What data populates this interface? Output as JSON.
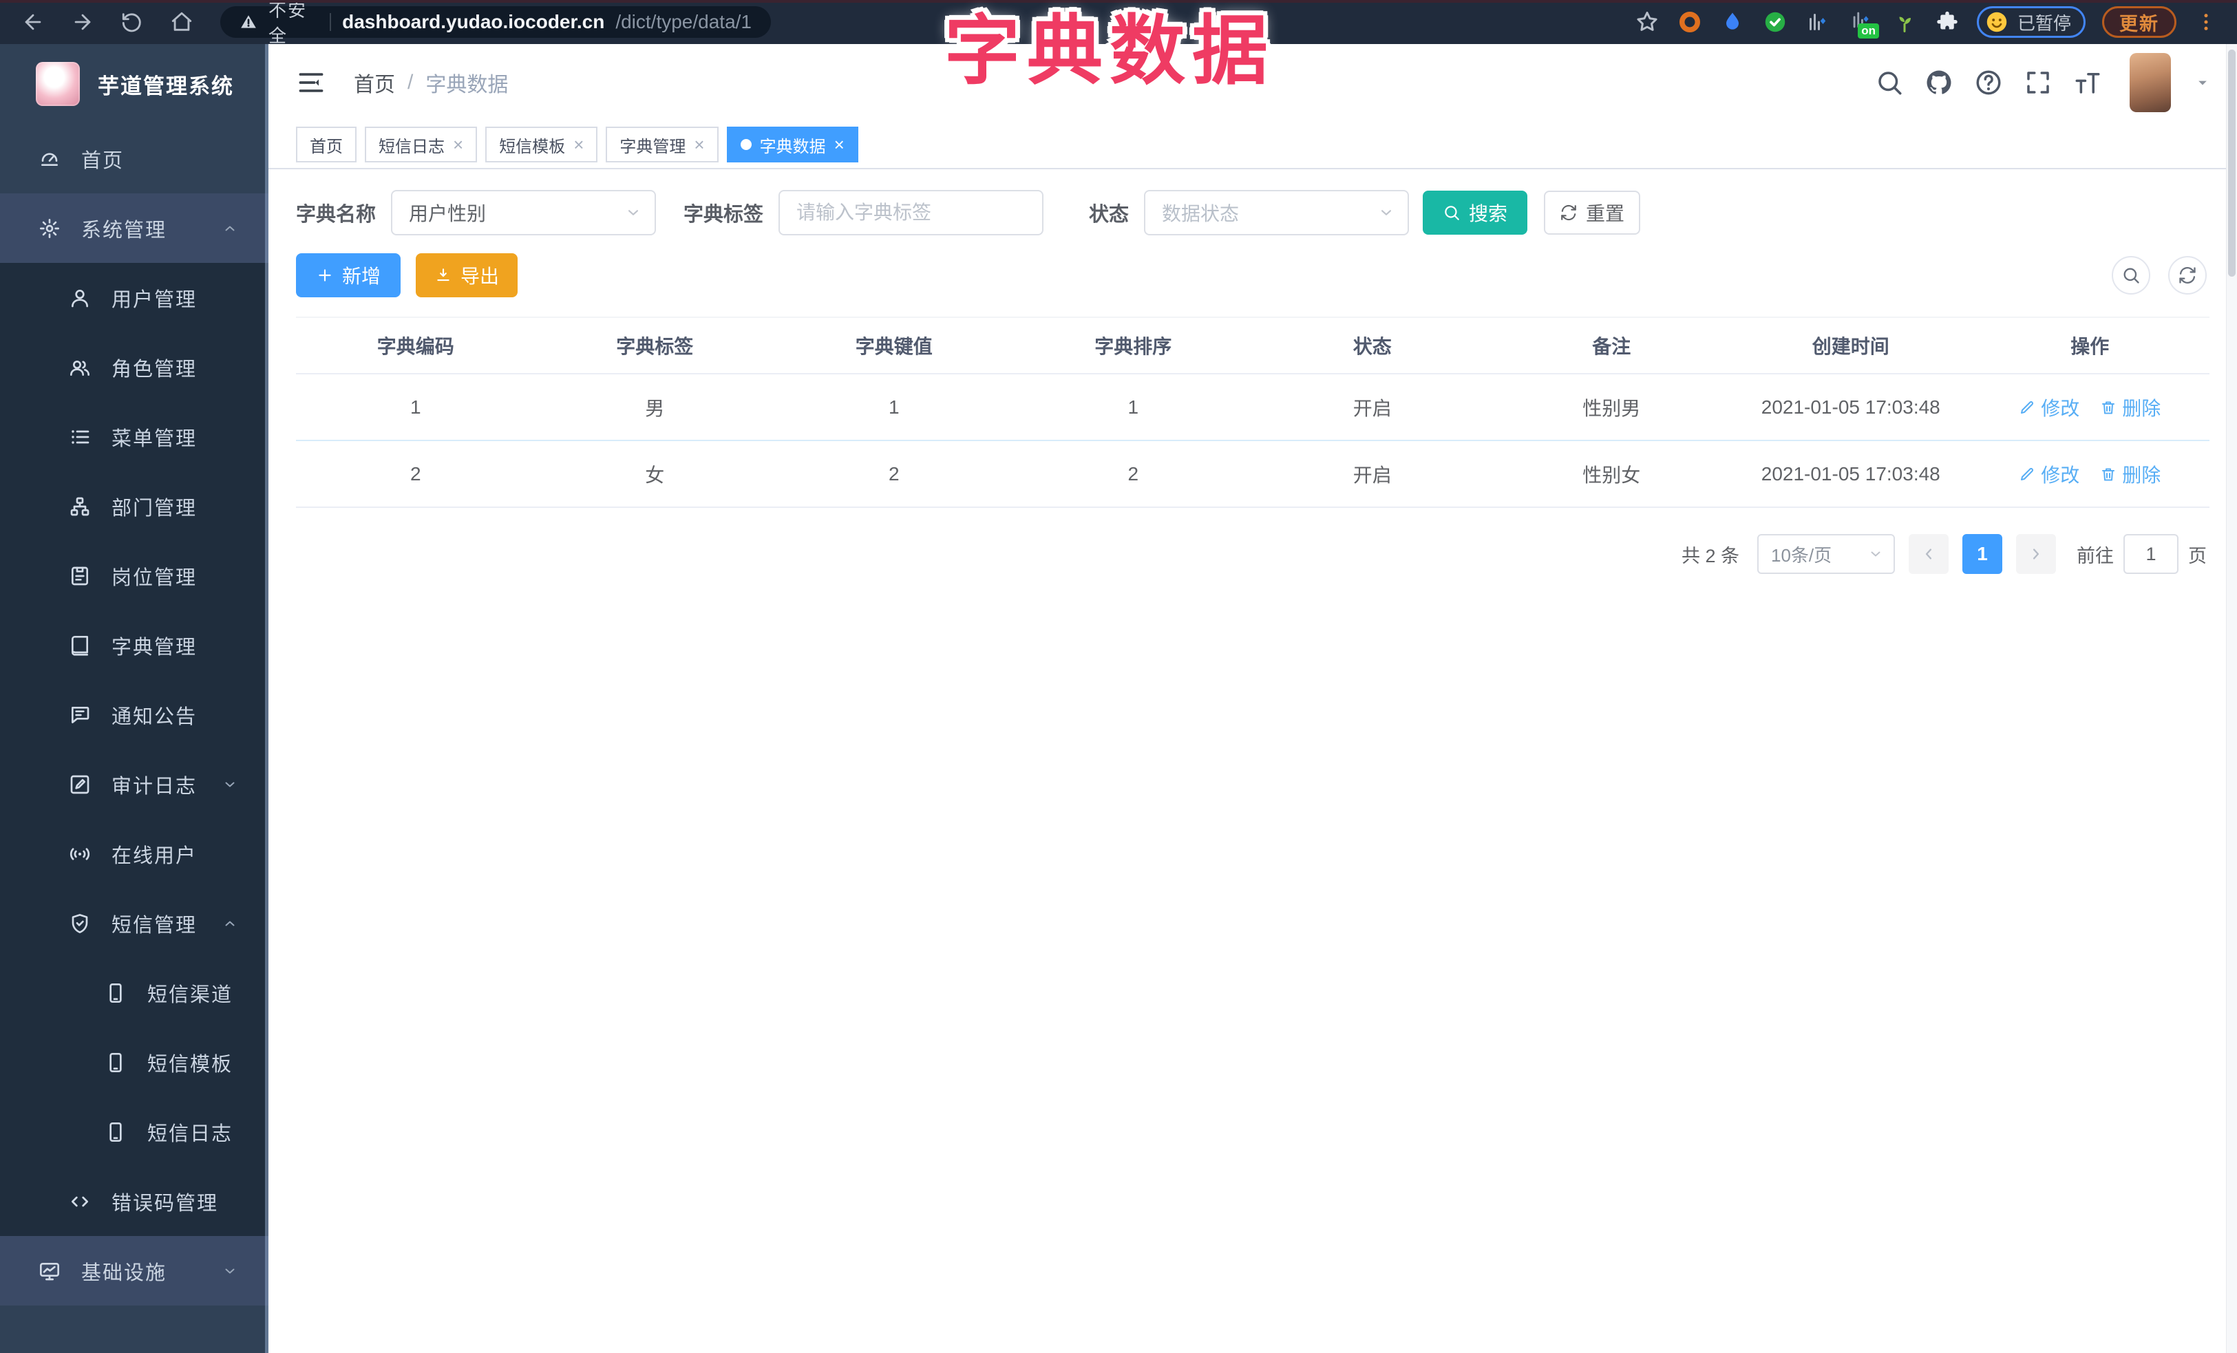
{
  "colors": {
    "accent": "#409EFF",
    "teal": "#19B8A5",
    "orange": "#F0A31F",
    "pink": "#EF3B63",
    "sidebar": "#304156",
    "submenu": "#1F2D3D",
    "chrome": "#202B3C"
  },
  "overlay_title": "字典数据",
  "browser": {
    "nav_icons": [
      "arrow-left-icon",
      "arrow-right-icon",
      "reload-icon",
      "home-icon"
    ],
    "security_label": "不安全",
    "url_host": "dashboard.yudao.iocoder.cn",
    "url_path": "/dict/type/data/1",
    "extensions": [
      "bookmark-star-icon",
      "donut-icon",
      "drop-icon",
      "check-circle-icon",
      "bars-icon",
      "on-badge-icon",
      "sprout-icon",
      "puzzle-icon"
    ],
    "on_badge": "on",
    "paused_label": "已暂停",
    "update_label": "更新"
  },
  "sidebar": {
    "app_title": "芋道管理系统",
    "items": [
      {
        "label": "首页",
        "icon": "gauge-icon",
        "level": 1
      },
      {
        "label": "系统管理",
        "icon": "gear-icon",
        "level": 1,
        "chevron": "up",
        "highlight": true
      },
      {
        "label": "用户管理",
        "icon": "user-icon",
        "level": 2
      },
      {
        "label": "角色管理",
        "icon": "users-icon",
        "level": 2
      },
      {
        "label": "菜单管理",
        "icon": "menu-list-icon",
        "level": 2
      },
      {
        "label": "部门管理",
        "icon": "org-tree-icon",
        "level": 2
      },
      {
        "label": "岗位管理",
        "icon": "badge-icon",
        "level": 2
      },
      {
        "label": "字典管理",
        "icon": "book-icon",
        "level": 2
      },
      {
        "label": "通知公告",
        "icon": "bubble-icon",
        "level": 2
      },
      {
        "label": "审计日志",
        "icon": "edit-note-icon",
        "level": 2,
        "chevron": "down"
      },
      {
        "label": "在线用户",
        "icon": "online-icon",
        "level": 2
      },
      {
        "label": "短信管理",
        "icon": "shield-check-icon",
        "level": 2,
        "chevron": "up"
      },
      {
        "label": "短信渠道",
        "icon": "phone-icon",
        "level": 3
      },
      {
        "label": "短信模板",
        "icon": "phone-icon",
        "level": 3
      },
      {
        "label": "短信日志",
        "icon": "phone-icon",
        "level": 3
      },
      {
        "label": "错误码管理",
        "icon": "code-icon",
        "level": 2
      },
      {
        "label": "基础设施",
        "icon": "monitor-icon",
        "level": 1,
        "chevron": "down",
        "highlight": true
      }
    ]
  },
  "header": {
    "breadcrumb_home": "首页",
    "breadcrumb_sep": "/",
    "breadcrumb_current": "字典数据",
    "icons": [
      "search-icon",
      "github-icon",
      "help-icon",
      "fullscreen-icon",
      "font-size-icon"
    ]
  },
  "tabs": [
    {
      "label": "首页",
      "closable": false,
      "active": false
    },
    {
      "label": "短信日志",
      "closable": true,
      "active": false
    },
    {
      "label": "短信模板",
      "closable": true,
      "active": false
    },
    {
      "label": "字典管理",
      "closable": true,
      "active": false
    },
    {
      "label": "字典数据",
      "closable": true,
      "active": true
    }
  ],
  "filters": {
    "dict_name_label": "字典名称",
    "dict_name_value": "用户性别",
    "dict_label_label": "字典标签",
    "dict_label_placeholder": "请输入字典标签",
    "status_label": "状态",
    "status_placeholder": "数据状态",
    "search_label": "搜索",
    "reset_label": "重置"
  },
  "toolbar": {
    "add_label": "新增",
    "export_label": "导出"
  },
  "table": {
    "columns": [
      "字典编码",
      "字典标签",
      "字典键值",
      "字典排序",
      "状态",
      "备注",
      "创建时间",
      "操作"
    ],
    "rows": [
      {
        "cells": [
          "1",
          "男",
          "1",
          "1",
          "开启",
          "性别男",
          "2021-01-05 17:03:48"
        ]
      },
      {
        "cells": [
          "2",
          "女",
          "2",
          "2",
          "开启",
          "性别女",
          "2021-01-05 17:03:48"
        ]
      }
    ],
    "edit_label": "修改",
    "delete_label": "删除"
  },
  "pagination": {
    "total": "共 2 条",
    "page_size": "10条/页",
    "current": "1",
    "goto_prefix": "前往",
    "goto_value": "1",
    "goto_suffix": "页"
  }
}
